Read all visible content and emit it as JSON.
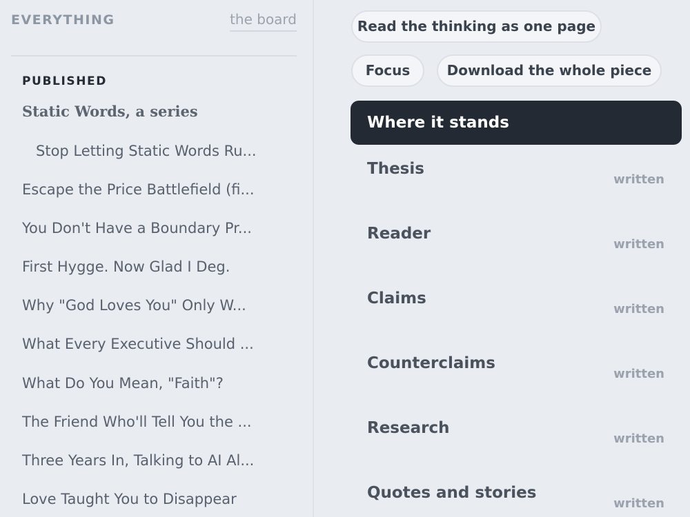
{
  "sidebar": {
    "title": "EVERYTHING",
    "board_link": "the board",
    "section_label": "PUBLISHED",
    "series_title": "Static Words, a series",
    "items": [
      {
        "label": "Stop Letting Static Words Ru...",
        "indent": true
      },
      {
        "label": "Escape the Price Battlefield (fi...",
        "indent": false
      },
      {
        "label": "You Don't Have a Boundary Pr...",
        "indent": false
      },
      {
        "label": "First Hygge. Now Glad I Deg.",
        "indent": false
      },
      {
        "label": "Why \"God Loves You\" Only W...",
        "indent": false
      },
      {
        "label": "What Every Executive Should ...",
        "indent": false
      },
      {
        "label": "What Do You Mean, \"Faith\"?",
        "indent": false
      },
      {
        "label": "The Friend Who'll Tell You the ...",
        "indent": false
      },
      {
        "label": "Three Years In, Talking to AI Al...",
        "indent": false
      },
      {
        "label": "Love Taught You to Disappear",
        "indent": false
      }
    ]
  },
  "toolbar": {
    "read_button": "Read the thinking as one page",
    "focus_button": "Focus",
    "download_button": "Download the whole piece"
  },
  "stages": {
    "active": "Where it stands",
    "items": [
      {
        "name": "Thesis",
        "status": "written"
      },
      {
        "name": "Reader",
        "status": "written"
      },
      {
        "name": "Claims",
        "status": "written"
      },
      {
        "name": "Counterclaims",
        "status": "written"
      },
      {
        "name": "Research",
        "status": "written"
      },
      {
        "name": "Quotes and stories",
        "status": "written"
      }
    ]
  },
  "colors": {
    "background": "#e9ecf1",
    "active_row_bg": "#232a33",
    "pill_bg": "#f3f5f8",
    "status_text": "#9aa2ad"
  }
}
